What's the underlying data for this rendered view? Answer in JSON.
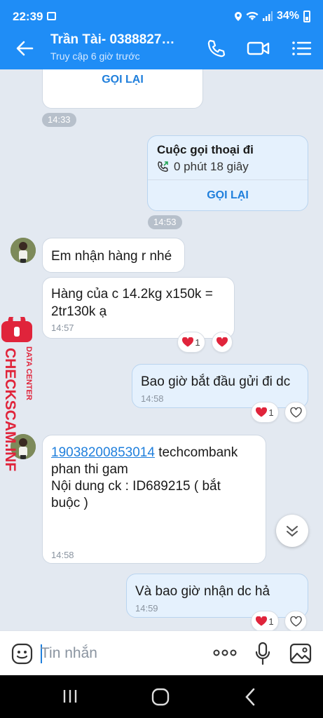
{
  "status_bar": {
    "time": "22:39",
    "battery": "34%"
  },
  "header": {
    "title": "Trần Tài- 0388827…",
    "subtitle": "Truy cập 6 giờ trước"
  },
  "messages": {
    "prev_incoming": {
      "button": "GỌI LẠI"
    },
    "stamp1": "14:33",
    "call_out": {
      "title": "Cuộc gọi thoại đi",
      "duration": "0 phút 18 giây",
      "button": "GỌI LẠI"
    },
    "stamp2": "14:53",
    "m1": {
      "text": "Em nhận hàng r nhé"
    },
    "m2": {
      "line1": "Hàng của c 14.2kg x150k =",
      "line2": "2tr130k ạ",
      "time": "14:57",
      "reaction_count": "1"
    },
    "m3": {
      "text": "Bao giờ bắt đầu gửi đi dc",
      "time": "14:58",
      "reaction_count": "1"
    },
    "m4": {
      "account": "19038200853014",
      "line1_rest": " techcombank",
      "line2": "phan thi gam",
      "line3": "Nội dung ck : ID689215 ( bắt",
      "line4": "buộc )",
      "time": "14:58"
    },
    "m5": {
      "text": "Và bao giờ nhận dc hả",
      "time": "14:59",
      "reaction_count": "1"
    }
  },
  "watermark": {
    "small": "DATA CENTER",
    "big": "CHECKSCAM.INFO"
  },
  "input": {
    "placeholder": "Tin nhắn"
  },
  "colors": {
    "brand": "#1f8df6",
    "heart": "#e0243b",
    "link": "#1f7fdc"
  }
}
